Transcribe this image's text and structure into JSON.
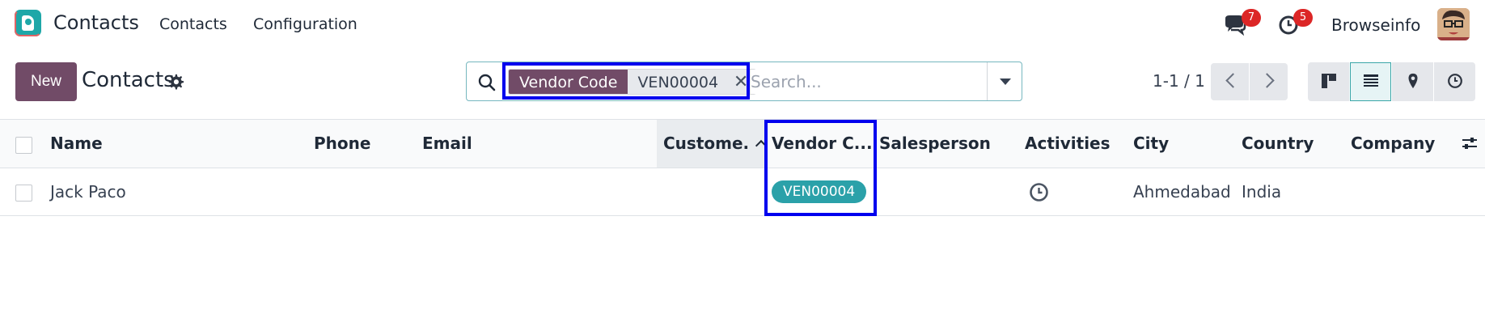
{
  "navbar": {
    "app_name": "Contacts",
    "menu": [
      "Contacts",
      "Configuration"
    ],
    "messages_count": "7",
    "activities_count": "5",
    "company": "Browseinfo"
  },
  "control_panel": {
    "new_label": "New",
    "title": "Contacts",
    "search": {
      "facet_label": "Vendor Code",
      "facet_value": "VEN00004",
      "facet_remove": "✕",
      "placeholder": "Search..."
    },
    "pager": "1-1 / 1"
  },
  "table": {
    "columns": [
      "Name",
      "Phone",
      "Email",
      "Custome.",
      "Vendor C...",
      "Salesperson",
      "Activities",
      "City",
      "Country",
      "Company"
    ],
    "rows": [
      {
        "name": "Jack Paco",
        "phone": "",
        "email": "",
        "customer_code": "",
        "vendor_code": "VEN00004",
        "salesperson": "",
        "activities": "clock-icon",
        "city": "Ahmedabad",
        "country": "India",
        "company": ""
      }
    ]
  },
  "colors": {
    "brand": "#714b67",
    "accent": "#2ba1a9",
    "highlight": "#0000ee",
    "badge": "#dc2626"
  }
}
